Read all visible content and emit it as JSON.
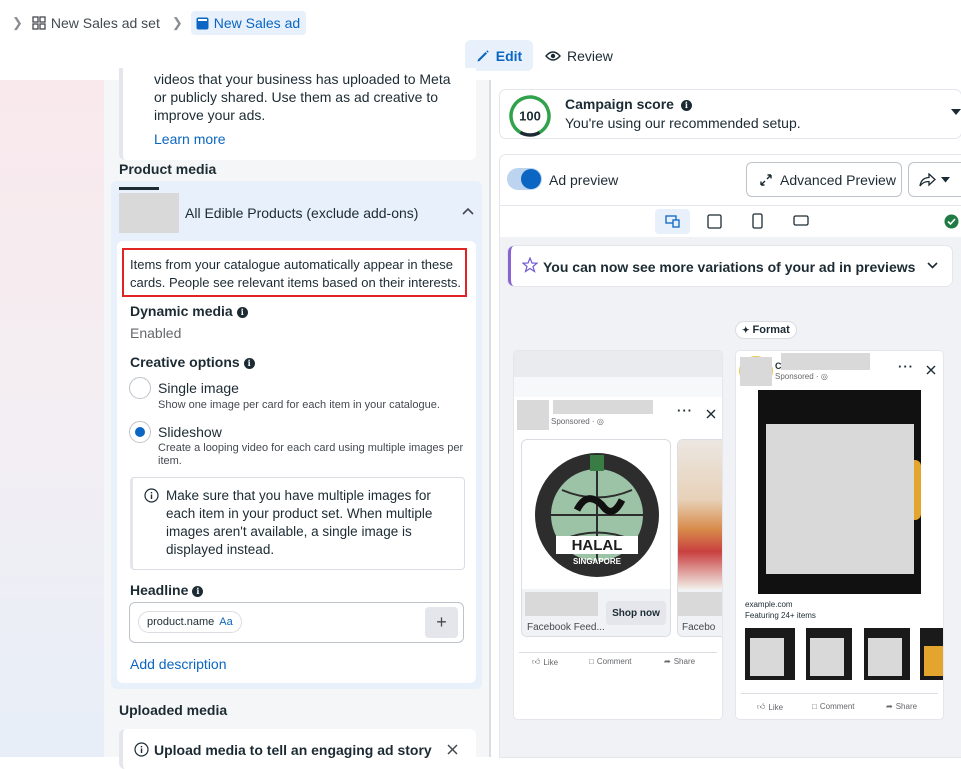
{
  "breadcrumb": {
    "adset_label": "New Sales ad set",
    "ad_label": "New Sales ad"
  },
  "tabs": {
    "edit": "Edit",
    "review": "Review"
  },
  "left": {
    "intro_text": "videos that your business has uploaded to Meta or publicly shared. Use them as ad creative to improve your ads.",
    "learn_more": "Learn more",
    "product_media_title": "Product media",
    "product_set_name": "All Edible Products (exclude add-ons)",
    "catalogue_note": "Items from your catalogue automatically appear in these cards. People see relevant items based on their interests.",
    "dynamic_media_label": "Dynamic media",
    "dynamic_media_value": "Enabled",
    "creative_options_label": "Creative options",
    "option_single_title": "Single image",
    "option_single_desc": "Show one image per card for each item in your catalogue.",
    "option_slideshow_title": "Slideshow",
    "option_slideshow_desc": "Create a looping video for each card using multiple images per item.",
    "selected_option": "Slideshow",
    "slideshow_notice": "Make sure that you have multiple images for each item in your product set. When multiple images aren't available, a single image is displayed instead.",
    "headline_label": "Headline",
    "headline_token": "product.name",
    "headline_token_suffix": "Aa",
    "add_description": "Add description",
    "uploaded_media_title": "Uploaded media",
    "upload_banner": "Upload media to tell an engaging ad story"
  },
  "right": {
    "campaign_score_value": "100",
    "campaign_score_title": "Campaign score",
    "campaign_score_desc": "You're using our recommended setup.",
    "ad_preview_label": "Ad preview",
    "ad_preview_enabled": true,
    "advanced_preview": "Advanced Preview",
    "variations_banner": "You can now see more variations of your ad in previews",
    "format_badge": "Format",
    "sponsored": "Sponsored · ",
    "card1_cta": "Shop now",
    "card1_caption": "Facebook Feed...",
    "card2_caption": "Facebo",
    "logo_text": "HALAL",
    "logo_sub": "SINGAPORE",
    "logo_arc": "MAJLIS UGAMA ISLAM SINGAPURA",
    "like": "Like",
    "comment": "Comment",
    "share": "Share",
    "story_domain": "example.com",
    "story_featuring": "Featuring 24+ items",
    "story_initial": "C"
  },
  "colors": {
    "accent": "#0a66c2",
    "score_green": "#31a24c",
    "highlight_border": "#e02424"
  }
}
